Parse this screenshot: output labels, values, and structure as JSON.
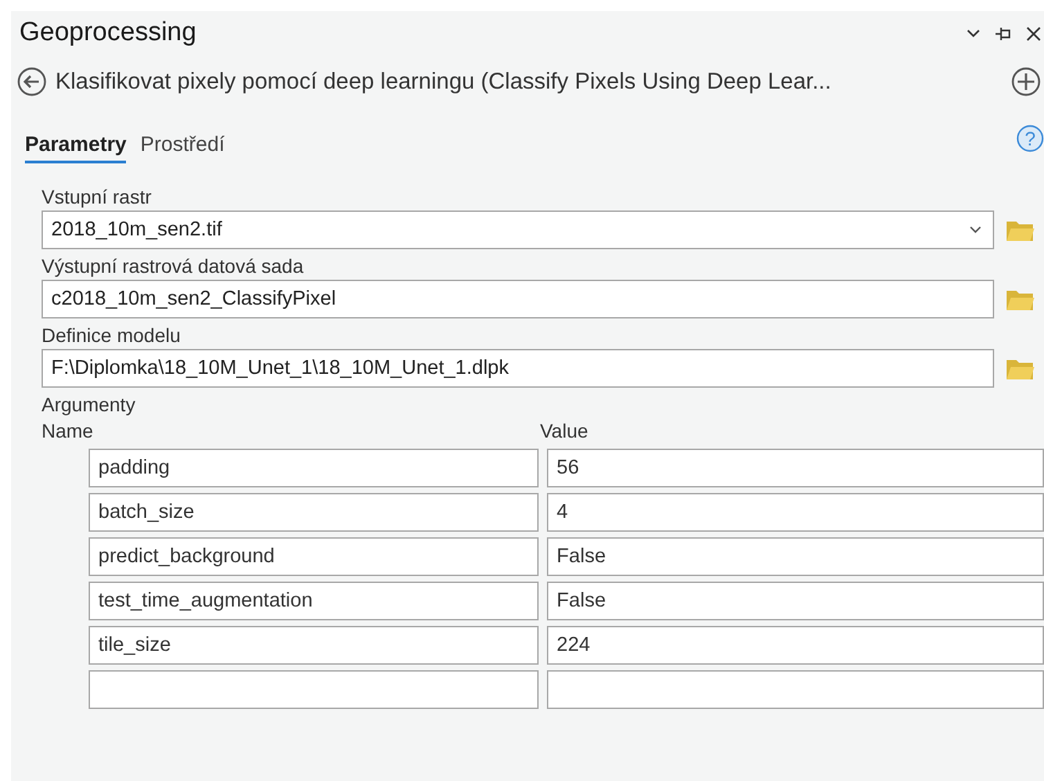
{
  "pane": {
    "title": "Geoprocessing",
    "tool_title": "Klasifikovat pixely pomocí deep learningu (Classify Pixels Using Deep Lear..."
  },
  "help_button": {
    "glyph": "?"
  },
  "tabs": [
    {
      "label": "Parametry",
      "selected": true
    },
    {
      "label": "Prostředí",
      "selected": false
    }
  ],
  "parameters": [
    {
      "label": "Vstupní rastr",
      "value": "2018_10m_sen2.tif",
      "kind": "dropdown"
    },
    {
      "label": "Výstupní rastrová datová sada",
      "value": "c2018_10m_sen2_ClassifyPixel",
      "kind": "text"
    },
    {
      "label": "Definice modelu",
      "value": "F:\\Diplomka\\18_10M_Unet_1\\18_10M_Unet_1.dlpk",
      "kind": "text"
    }
  ],
  "arguments": {
    "label": "Argumenty",
    "columns": [
      "Name",
      "Value"
    ],
    "rows": [
      {
        "kind": "param",
        "name": "padding",
        "value": "56"
      },
      {
        "kind": "param",
        "name": "batch_size",
        "value": "4"
      },
      {
        "kind": "param",
        "name": "predict_background",
        "value": "False"
      },
      {
        "kind": "param",
        "name": "test_time_augmentation",
        "value": "False"
      },
      {
        "kind": "param",
        "name": "tile_size",
        "value": "224"
      },
      {
        "kind": "empty"
      }
    ]
  }
}
